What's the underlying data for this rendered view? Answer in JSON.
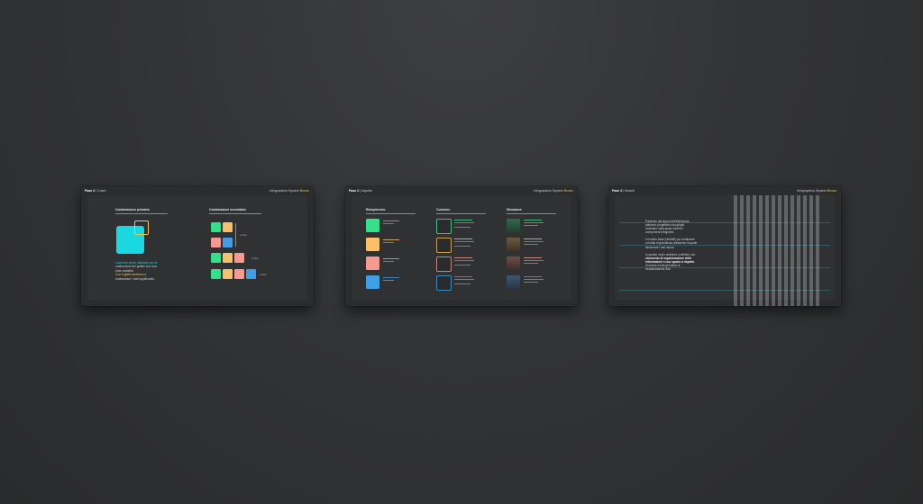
{
  "slides": [
    {
      "header": {
        "phase": "Fase 2",
        "section": "| Colori"
      },
      "brand": {
        "name": "Infographics System",
        "accent": "Brown"
      },
      "primary_title": "Combinazione primaria",
      "secondary_title": "Combinazioni secondarie",
      "description": {
        "l1": "L'azzurro viene utilizzato per la",
        "l2": "costruzione dei grafici con una",
        "l3": "sola variabile.",
        "l4": "Con il giallo andiamo a",
        "l5": "evidenziare i dati significativi."
      },
      "labels": {
        "two": "2 colori",
        "three": "3 colori",
        "four": "4 colori"
      }
    },
    {
      "header": {
        "phase": "Fase 2",
        "section": "| Aspetto"
      },
      "brand": {
        "name": "Infographics System",
        "accent": "Brown"
      },
      "col1": "Riempimento",
      "col2": "Contorno",
      "col3": "Sfumature"
    },
    {
      "header": {
        "phase": "Fase 2",
        "section": "| Moduli"
      },
      "brand": {
        "name": "Infographics System",
        "accent": "Brown"
      },
      "paragraphs": {
        "p1": [
          "Partendo dal layout dell'interfaccia",
          "abbiamo progettato una griglia",
          "modulare sulla quale inserire i",
          "componenti infografici."
        ],
        "p2": [
          "Il modulo base (riferibili) poi costituisce",
          "un'unità di grandezza attraverso la quale",
          "strutturare i vari layout."
        ],
        "p3": [
          "In questo modo andiamo a definire uno",
          "strumento di organizzazione delle",
          "informazioni e uno spazio a rispetto",
          "di azione a tutti gli intenti di",
          "visualizzazione dati."
        ]
      }
    }
  ],
  "colors": {
    "cyan": "#19d8e0",
    "yellow": "#f0c845",
    "green": "#36e08a",
    "orange": "#f8c06a",
    "pink": "#f49a90",
    "blue": "#3f9ee5"
  }
}
